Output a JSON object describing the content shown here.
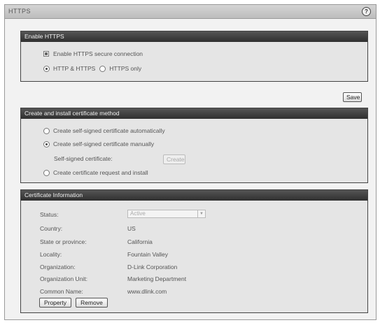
{
  "window": {
    "title": "HTTPS",
    "help_icon": "?"
  },
  "enable_https": {
    "header": "Enable HTTPS",
    "checkbox_label": "Enable HTTPS secure connection",
    "checkbox_checked": true,
    "mode_options": [
      {
        "label": "HTTP & HTTPS",
        "selected": true
      },
      {
        "label": "HTTPS only",
        "selected": false
      }
    ]
  },
  "save_button": "Save",
  "certificate_method": {
    "header": "Create and install certificate method",
    "options": [
      {
        "label": "Create self-signed certificate automatically",
        "selected": false
      },
      {
        "label": "Create self-signed certificate manually",
        "selected": true
      },
      {
        "label": "Create certificate request and install",
        "selected": false
      }
    ],
    "self_signed_label": "Self-signed certificate:",
    "create_button": "Create"
  },
  "certificate_info": {
    "header": "Certificate Information",
    "status_label": "Status:",
    "status_value": "Active",
    "fields": [
      {
        "label": "Country:",
        "value": "US"
      },
      {
        "label": "State or province:",
        "value": "California"
      },
      {
        "label": "Locality:",
        "value": "Fountain Valley"
      },
      {
        "label": "Organization:",
        "value": "D-Link Corporation"
      },
      {
        "label": "Organization Unit:",
        "value": "Marketing Department"
      },
      {
        "label": "Common Name:",
        "value": "www.dlink.com"
      }
    ],
    "property_button": "Property",
    "remove_button": "Remove"
  }
}
